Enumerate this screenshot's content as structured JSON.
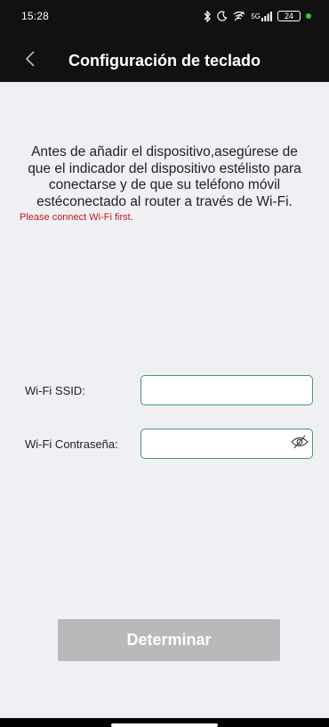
{
  "status_bar": {
    "time": "15:28",
    "network": "5G",
    "battery": "24",
    "indicator_color": "#2ecc40"
  },
  "header": {
    "back_icon": "chevron-left-icon",
    "title": "Configuración de teclado"
  },
  "content": {
    "instruction": "Antes de añadir el dispositivo,asegúrese de que el indicador del dispositivo estélisto para conectarse y de que su teléfono móvil estéconectado al router a través de Wi-Fi.",
    "warning": "Please connect Wi-Fi first."
  },
  "form": {
    "ssid_label": "Wi-Fi SSID:",
    "ssid_value": "",
    "password_label": "Wi-Fi Contraseña:",
    "password_value": "",
    "eye_icon": "eye-off-icon",
    "border_color": "#3f9b72"
  },
  "actions": {
    "submit_label": "Determinar",
    "submit_color": "#b8b9bb"
  },
  "colors": {
    "header_bg": "#111111",
    "page_bg": "#eef0f4",
    "warning": "#c4171c"
  }
}
